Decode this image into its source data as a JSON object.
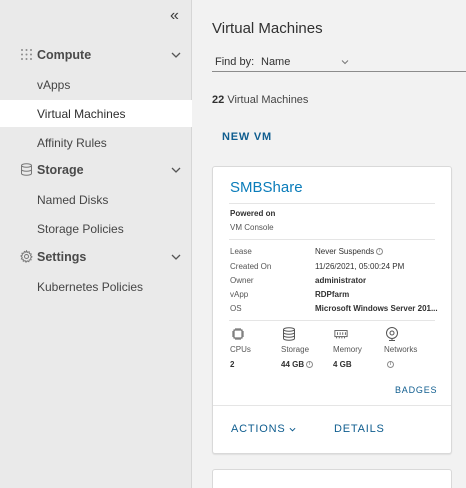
{
  "sidebar": {
    "collapse_glyph": "«",
    "sections": [
      {
        "label": "Compute",
        "icon": "grid-icon",
        "items": [
          "vApps",
          "Virtual Machines",
          "Affinity Rules"
        ]
      },
      {
        "label": "Storage",
        "icon": "storage-icon",
        "items": [
          "Named Disks",
          "Storage Policies"
        ]
      },
      {
        "label": "Settings",
        "icon": "gear-icon",
        "items": [
          "Kubernetes Policies"
        ]
      }
    ],
    "active_item": "Virtual Machines"
  },
  "main": {
    "title": "Virtual Machines",
    "find_by_label": "Find by:",
    "find_by_value": "Name",
    "count_number": "22",
    "count_label": "Virtual Machines",
    "new_vm_label": "NEW VM"
  },
  "card": {
    "title": "SMBShare",
    "power_state": "Powered on",
    "console_label": "VM Console",
    "lease_label": "Lease",
    "lease_value": "Never Suspends",
    "created_label": "Created On",
    "created_value": "11/26/2021, 05:00:24 PM",
    "owner_label": "Owner",
    "owner_value": "administrator",
    "vapp_label": "vApp",
    "vapp_value": "RDPfarm",
    "os_label": "OS",
    "os_value": "Microsoft Windows Server 201...",
    "cpus_label": "CPUs",
    "cpus_value": "2",
    "storage_label": "Storage",
    "storage_value": "44 GB",
    "memory_label": "Memory",
    "memory_value": "4 GB",
    "networks_label": "Networks",
    "badges_label": "BADGES",
    "actions_label": "ACTIONS",
    "details_label": "DETAILS"
  },
  "colors": {
    "link": "#0f5d8f",
    "title_link": "#0a7cba",
    "active_bg": "#ffffff"
  }
}
